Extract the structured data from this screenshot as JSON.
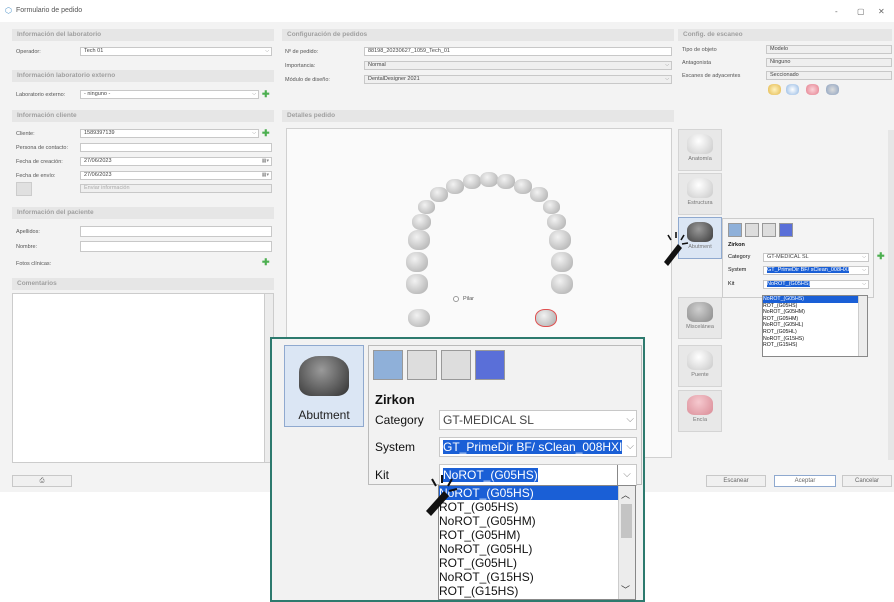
{
  "window": {
    "title": "Formulario de pedido",
    "controls": [
      "-",
      "▢",
      "✕"
    ]
  },
  "lab": {
    "header": "Información del laboratorio",
    "operator_label": "Operador:",
    "operator_value": "Tech 01"
  },
  "external_lab": {
    "header": "Información laboratorio externo",
    "label": "Laboratorio externo:",
    "value": "- ninguno -"
  },
  "client": {
    "header": "Información cliente",
    "client_label": "Cliente:",
    "client_value": "1589397139",
    "contact_label": "Persona de contacto:",
    "contact_value": "",
    "created_label": "Fecha de creación:",
    "created_value": "27/06/2023",
    "sent_label": "Fecha de envío:",
    "sent_value": "27/06/2023",
    "send_info": "Enviar información"
  },
  "patient": {
    "header": "Información del paciente",
    "surname_label": "Apellidos:",
    "name_label": "Nombre:",
    "photos_label": "Fotos clínicas:"
  },
  "comments": {
    "header": "Comentarios"
  },
  "order_config": {
    "header": "Configuración de pedidos",
    "order_label": "Nº de pedido:",
    "order_value": "88198_20230627_1059_Tech_01",
    "importance_label": "Importancia:",
    "importance_value": "Normal",
    "module_label": "Módulo de diseño:",
    "module_value": "DentalDesigner 2021"
  },
  "scan_config": {
    "header": "Config. de escaneo",
    "type_label": "Tipo de objeto",
    "type_value": "Modelo",
    "antagonist_label": "Antagonista",
    "antagonist_value": "Ninguno",
    "adjacent_label": "Escanes de adyacentes",
    "adjacent_value": "Seccionado"
  },
  "details": {
    "header": "Detalles pedido",
    "pilar_label": "Pilar"
  },
  "side_buttons": {
    "anatomia": "Anatomía",
    "estructura": "Estructura",
    "abutment": "Abutment",
    "miscelanea": "Miscelánea",
    "puente": "Puente",
    "encia": "Encía"
  },
  "bottom": {
    "scan": "Escanear",
    "accept": "Aceptar",
    "cancel": "Cancelar"
  },
  "abutment_popup": {
    "material": "Zirkon",
    "category_label": "Category",
    "category_value": "GT-MEDICAL SL",
    "system_label": "System",
    "system_value": "GT_PrimeDir BF/ sClean_008HXI",
    "kit_label": "Kit",
    "kit_value": "NoROT_(G05HS)",
    "kit_options": [
      "NoROT_(G05HS)",
      "ROT_(G05HS)",
      "NoROT_(G05HM)",
      "ROT_(G05HM)",
      "NoROT_(G05HL)",
      "ROT_(G05HL)",
      "NoROT_(G15HS)",
      "ROT_(G15HS)"
    ]
  },
  "colors": {
    "accent_blue": "#1a5fd6",
    "zoom_border": "#2d7a6e",
    "plus_green": "#4caf50"
  }
}
